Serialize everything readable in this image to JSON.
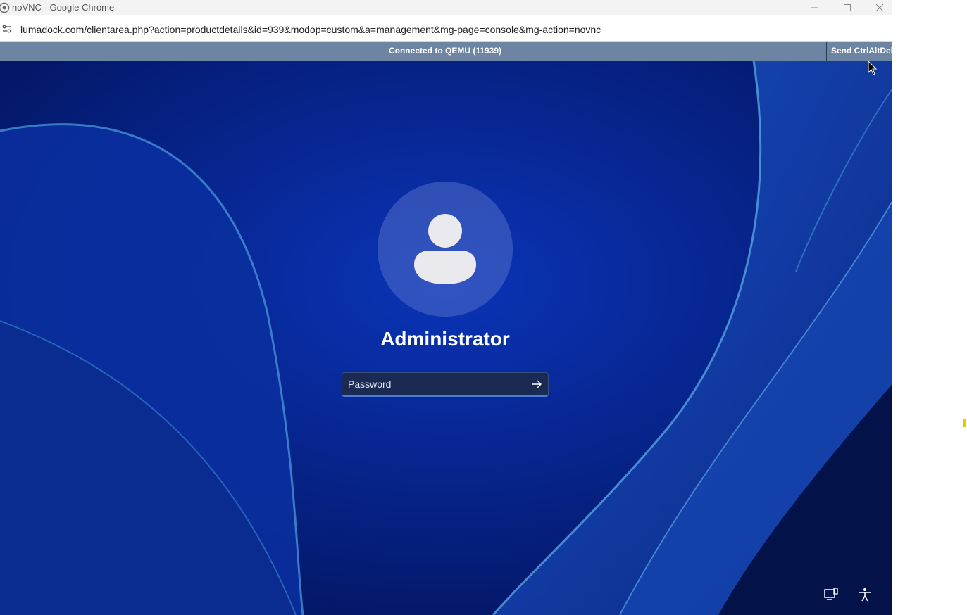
{
  "browser": {
    "window_title": "noVNC - Google Chrome",
    "url": "lumadock.com/clientarea.php?action=productdetails&id=939&modop=custom&a=management&mg-page=console&mg-action=novnc"
  },
  "vnc": {
    "status": "Connected to QEMU (11939)",
    "send_cad_label": "Send CtrlAltDel"
  },
  "login": {
    "username": "Administrator",
    "password_placeholder": "Password"
  },
  "colors": {
    "vnc_bar": "#6e84a3",
    "wallpaper_base": "#062a9a",
    "accent": "#4b7bd6"
  },
  "icons": {
    "titlebar": [
      "chrome-icon",
      "minimize-icon",
      "maximize-icon",
      "close-icon"
    ],
    "address": "site-info-icon",
    "avatar": "user-icon",
    "submit": "arrow-right-icon",
    "tray": [
      "network-icon",
      "accessibility-icon"
    ]
  }
}
